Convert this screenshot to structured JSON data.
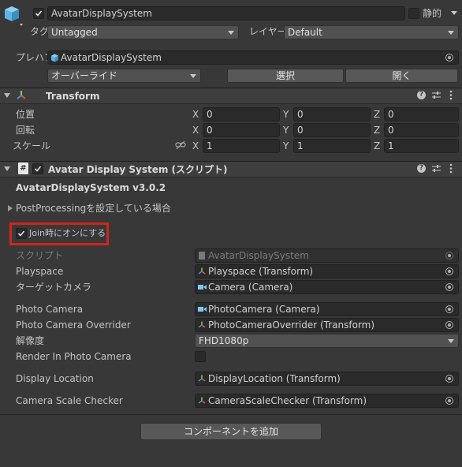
{
  "header": {
    "object_name": "AvatarDisplaySystem",
    "static_label": "静的",
    "tag_label": "タグ",
    "tag_value": "Untagged",
    "layer_label": "レイヤー",
    "layer_value": "Default",
    "prefab_label": "プレハブ",
    "prefab_value": "AvatarDisplaySystem",
    "overrides_value": "オーバーライド",
    "select_button": "選択",
    "open_button": "開く"
  },
  "transform": {
    "title": "Transform",
    "position_label": "位置",
    "rotation_label": "回転",
    "scale_label": "スケール",
    "axis_x": "X",
    "axis_y": "Y",
    "axis_z": "Z",
    "position": [
      "0",
      "0",
      "0"
    ],
    "rotation": [
      "0",
      "0",
      "0"
    ],
    "scale": [
      "1",
      "1",
      "1"
    ]
  },
  "component": {
    "title": "Avatar Display System (スクリプト)",
    "version": "AvatarDisplaySystem v3.0.2",
    "postprocessing_foldout": "PostProcessingを設定している場合",
    "join_checkbox_label": "Join時にオンにする",
    "script_label": "スクリプト",
    "script_value": "AvatarDisplaySystem",
    "playspace_label": "Playspace",
    "playspace_value": "Playspace (Transform)",
    "target_camera_label": "ターゲットカメラ",
    "target_camera_value": "Camera (Camera)",
    "photo_camera_label": "Photo Camera",
    "photo_camera_value": "PhotoCamera (Camera)",
    "photo_camera_overrider_label": "Photo Camera Overrider",
    "photo_camera_overrider_value": "PhotoCameraOverrider (Transform)",
    "resolution_label": "解像度",
    "resolution_value": "FHD1080p",
    "render_in_photo_label": "Render In Photo Camera",
    "display_location_label": "Display Location",
    "display_location_value": "DisplayLocation (Transform)",
    "camera_scale_checker_label": "Camera Scale Checker",
    "camera_scale_checker_value": "CameraScaleChecker (Transform)"
  },
  "footer": {
    "add_component_button": "コンポーネントを追加"
  },
  "colors": {
    "background": "#383838",
    "highlight_box": "#d4231f",
    "cube_icon": "#5fb4e6"
  }
}
